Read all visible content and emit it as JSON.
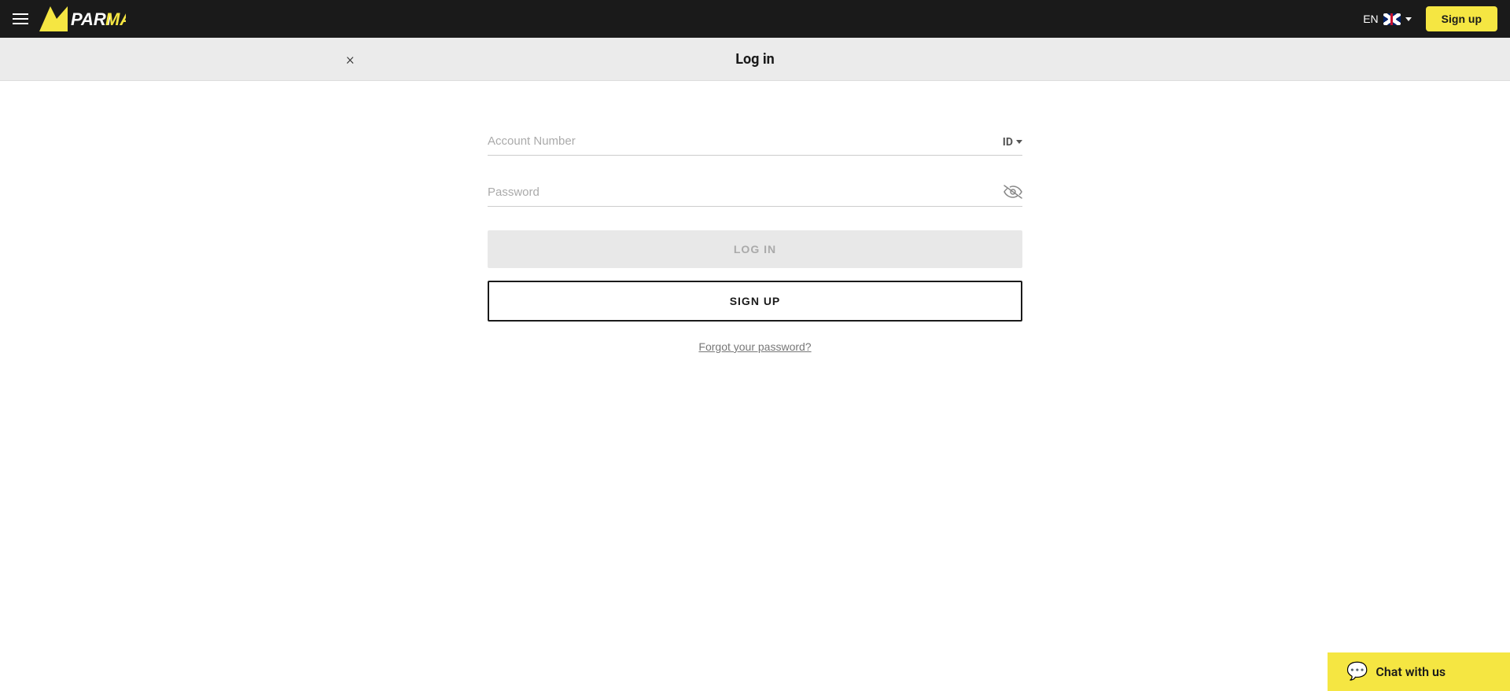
{
  "navbar": {
    "logo_pari": "PARI",
    "logo_match": "MATCH",
    "lang_code": "EN",
    "signup_label": "Sign up"
  },
  "modal": {
    "close_label": "×",
    "title": "Log in"
  },
  "form": {
    "account_placeholder": "Account Number",
    "id_suffix": "ID",
    "password_placeholder": "Password",
    "login_button": "LOG IN",
    "signup_button": "SIGN UP",
    "forgot_link": "Forgot your password?"
  },
  "chat": {
    "label": "Chat with us"
  }
}
